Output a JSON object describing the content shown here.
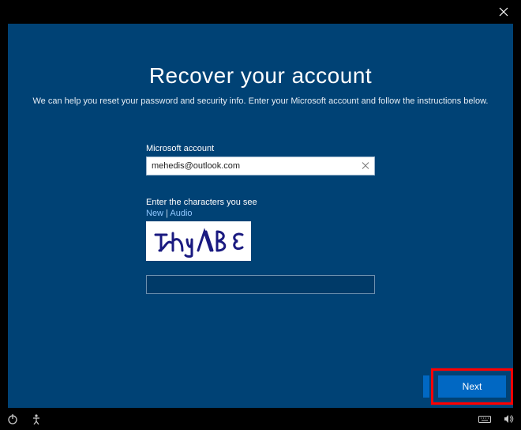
{
  "header": {
    "title": "Recover your account",
    "subtitle": "We can help you reset your password and security info. Enter your Microsoft account and follow the instructions below."
  },
  "form": {
    "account_label": "Microsoft account",
    "account_value": "mehedis@outlook.com",
    "captcha_label": "Enter the characters you see",
    "captcha_link_new": "New",
    "captcha_link_sep": " | ",
    "captcha_link_audio": "Audio",
    "captcha_text": "thyND6",
    "captcha_input_value": ""
  },
  "buttons": {
    "next": "Next"
  }
}
